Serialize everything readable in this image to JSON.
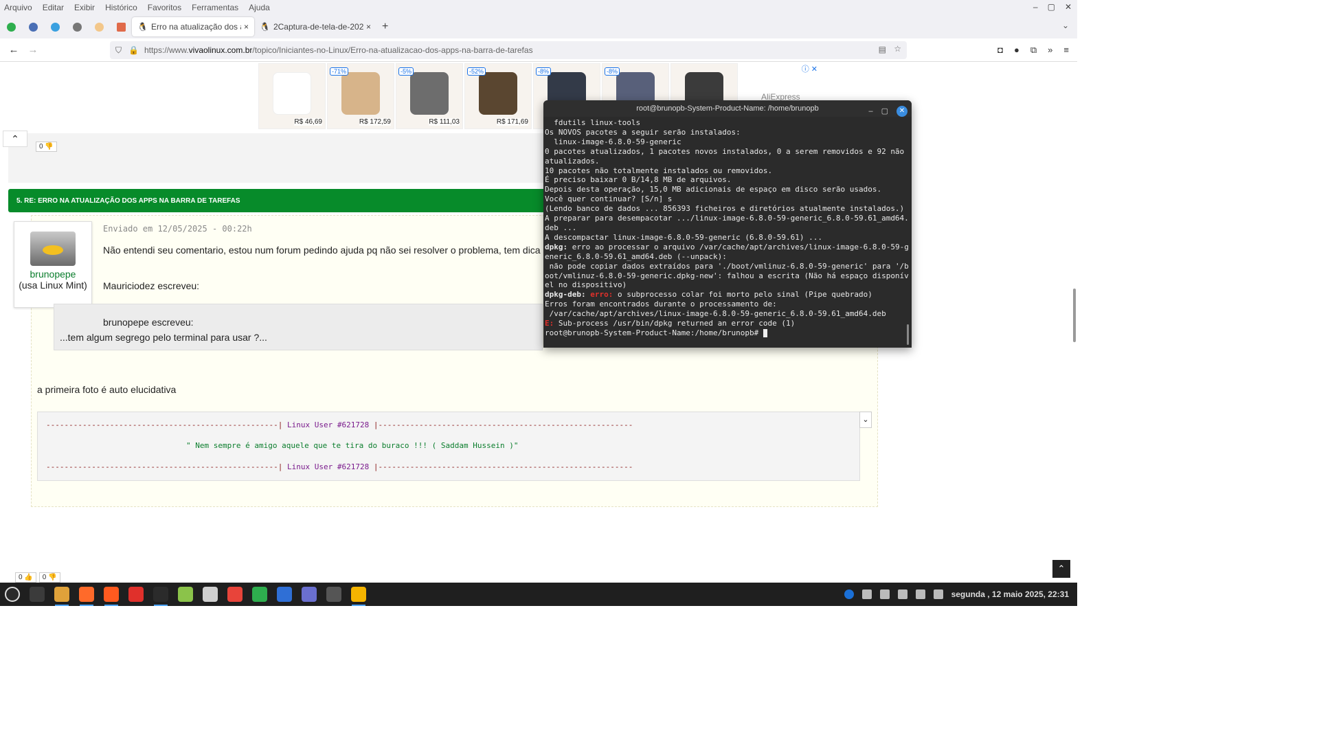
{
  "menu": [
    "Arquivo",
    "Editar",
    "Exibir",
    "Histórico",
    "Favoritos",
    "Ferramentas",
    "Ajuda"
  ],
  "tabs": [
    {
      "title": "Erro na atualização dos apps",
      "close": "×"
    },
    {
      "title": "2Captura-de-tela-de-2025-0",
      "close": "×"
    }
  ],
  "new_tab": "+",
  "url": {
    "prefix": "https://www.",
    "domain": "vivaolinux.com.br",
    "path": "/topico/Iniciantes-no-Linux/Erro-na-atualizacao-dos-apps-na-barra-de-tarefas"
  },
  "ads": [
    {
      "discount": "",
      "price": "R$ 46,69",
      "color": "#ffffff"
    },
    {
      "discount": "-71%",
      "price": "R$ 172,59",
      "color": "#d7b48a"
    },
    {
      "discount": "-5%",
      "price": "R$ 111,03",
      "color": "#6d6d6d"
    },
    {
      "discount": "-52%",
      "price": "R$ 171,69",
      "color": "#5a4630"
    },
    {
      "discount": "-8%",
      "price": "",
      "color": "#333a48"
    },
    {
      "discount": "-8%",
      "price": "",
      "color": "#58607a"
    },
    {
      "discount": "",
      "price": "",
      "color": "#3b3b3b"
    }
  ],
  "ad_brand": "AliExpress",
  "ad_close": "ⓘ ✕",
  "votes_top": {
    "up": "0",
    "down": "0"
  },
  "votes_bottom": {
    "up": "0",
    "down": "0"
  },
  "post_header": "5. RE: ERRO NA ATUALIZAÇÃO DOS APPS NA BARRA DE TAREFAS",
  "author": {
    "name": "brunopepe",
    "distro": "(usa Linux Mint)"
  },
  "post_meta": "Enviado em 12/05/2025 - 00:22h",
  "post_body": "Não entendi seu comentario, estou num forum pedindo ajuda pq não sei resolver o problema, tem dica de",
  "quote1": "Mauriciodez escreveu:",
  "quote2_author": "brunopepe escreveu:",
  "quote2_text": "...tem algum segrego pelo terminal para usar ?...",
  "post_body2": "a primeira foto é auto elucidativa",
  "signature": {
    "dashes_left": "---------------------------------------------------|",
    "user": " Linux User #621728 ",
    "dashes_right": "|--------------------------------------------------------",
    "quote": "\" Nem sempre é amigo aquele que te tira do buraco !!! ( Saddam Hussein )\""
  },
  "terminal": {
    "title": "root@brunopb-System-Product-Name: /home/brunopb",
    "lines": [
      {
        "t": "  fdutils linux-tools"
      },
      {
        "t": "Os NOVOS pacotes a seguir serão instalados:"
      },
      {
        "t": "  linux-image-6.8.0-59-generic"
      },
      {
        "t": "0 pacotes atualizados, 1 pacotes novos instalados, 0 a serem removidos e 92 não atualizados."
      },
      {
        "t": "10 pacotes não totalmente instalados ou removidos."
      },
      {
        "t": "É preciso baixar 0 B/14,8 MB de arquivos."
      },
      {
        "t": "Depois desta operação, 15,0 MB adicionais de espaço em disco serão usados."
      },
      {
        "t": "Você quer continuar? [S/n] s"
      },
      {
        "t": "(Lendo banco de dados ... 856393 ficheiros e diretórios atualmente instalados.)"
      },
      {
        "t": "A preparar para desempacotar .../linux-image-6.8.0-59-generic_6.8.0-59.61_amd64.deb ..."
      },
      {
        "t": "A descompactar linux-image-6.8.0-59-generic (6.8.0-59.61) ..."
      },
      {
        "p": "dpkg:",
        "e": "",
        "t": " erro ao processar o arquivo /var/cache/apt/archives/linux-image-6.8.0-59-generic_6.8.0-59.61_amd64.deb (--unpack):"
      },
      {
        "t": " não pode copiar dados extraídos para './boot/vmlinuz-6.8.0-59-generic' para '/boot/vmlinuz-6.8.0-59-generic.dpkg-new': falhou a escrita (Não há espaço disponível no dispositivo)"
      },
      {
        "p": "dpkg-deb:",
        "e": " erro:",
        "t": " o subprocesso colar foi morto pelo sinal (Pipe quebrado)"
      },
      {
        "t": "Erros foram encontrados durante o processamento de:"
      },
      {
        "t": " /var/cache/apt/archives/linux-image-6.8.0-59-generic_6.8.0-59.61_amd64.deb"
      },
      {
        "p": "",
        "e": "E:",
        "t": " Sub-process /usr/bin/dpkg returned an error code (1)"
      }
    ],
    "prompt": "root@brunopb-System-Product-Name:/home/brunopb# "
  },
  "taskbar": {
    "apps": [
      "#3b3b3b",
      "#e0a23a",
      "#ff6a2a",
      "#ff5a1f",
      "#e0302b",
      "#2b2b2b",
      "#8bc34a",
      "#cfcfcf",
      "#e8443a",
      "#2eae4e",
      "#2f6fd6",
      "#6a6fcf",
      "#555555",
      "#f5b400"
    ]
  },
  "clock": "segunda , 12 maio 2025, 22:31",
  "colors": {
    "green_header": "#078b2a",
    "username": "#0a7d2c"
  }
}
